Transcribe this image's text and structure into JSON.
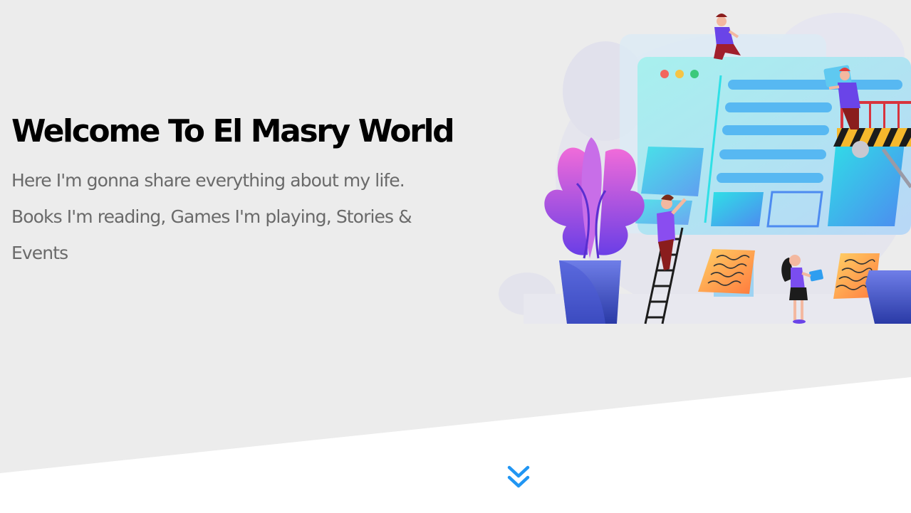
{
  "landing": {
    "title": "Welcome To El Masry World",
    "description": "Here I'm gonna share everything about my life. Books I'm reading, Games I'm playing, Stories & Events"
  },
  "colors": {
    "background_gray": "#ececec",
    "background_white": "#ffffff",
    "title": "#000000",
    "text": "#6a6a6a",
    "accent": "#2196f3"
  },
  "icons": {
    "go_down": "double-chevron-down-icon"
  }
}
